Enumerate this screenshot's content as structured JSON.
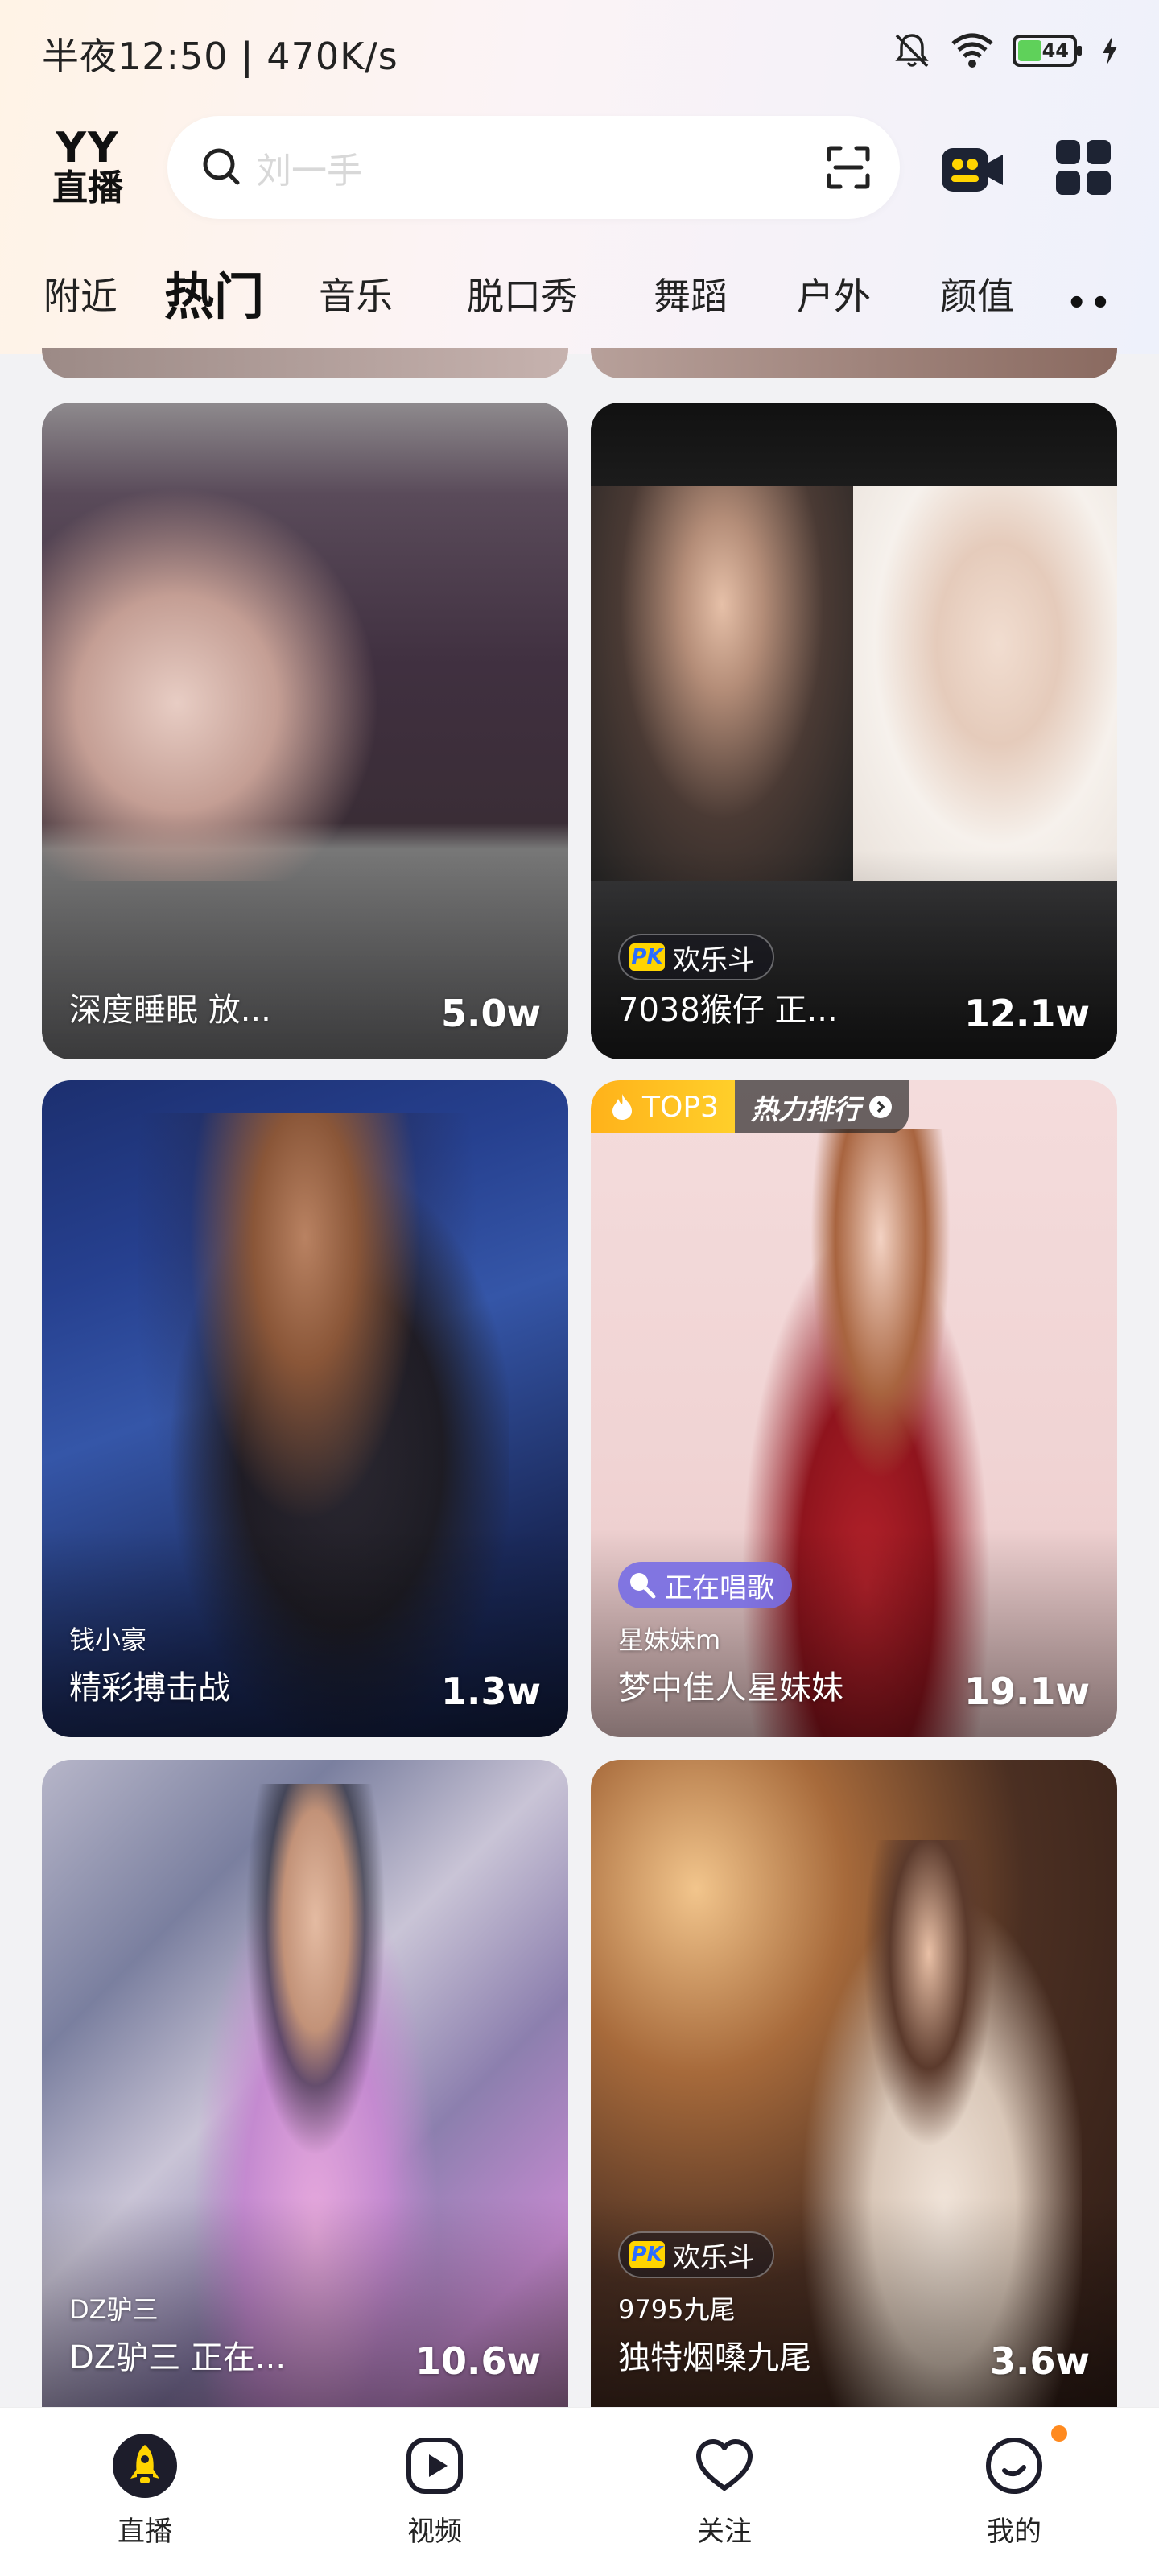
{
  "status_bar": {
    "time": "半夜12:50 | 470K/s",
    "battery": "44"
  },
  "header": {
    "logo_top": "YY",
    "logo_bottom": "直播",
    "search_placeholder": "刘一手"
  },
  "tabs": [
    {
      "label": "附近"
    },
    {
      "label": "热门"
    },
    {
      "label": "音乐"
    },
    {
      "label": "脱口秀"
    },
    {
      "label": "舞蹈"
    },
    {
      "label": "户外"
    },
    {
      "label": "颜值"
    }
  ],
  "more_label": "••",
  "cards": [
    {
      "title": "深度睡眠 放...",
      "count": "5.0w"
    },
    {
      "badge": "欢乐斗",
      "title": "7038猴仔 正...",
      "count": "12.1w"
    },
    {
      "host": "钱小豪",
      "title": "精彩搏击战",
      "count": "1.3w"
    },
    {
      "rank": "TOP3",
      "rank_label": "热力排行",
      "badge": "正在唱歌",
      "host": "星妹妹m",
      "title": "梦中佳人星妹妹",
      "count": "19.1w"
    },
    {
      "host": "DZ驴三",
      "title": "DZ驴三 正在...",
      "count": "10.6w"
    },
    {
      "badge": "欢乐斗",
      "host": "9795九尾",
      "title": "独特烟嗓九尾",
      "count": "3.6w"
    }
  ],
  "bottom_nav": [
    {
      "label": "直播"
    },
    {
      "label": "视频"
    },
    {
      "label": "关注"
    },
    {
      "label": "我的"
    }
  ],
  "colors": {
    "accent_yellow": "#ffd400",
    "notification_dot": "#ff8a1f",
    "pill_purple": "#786ee6"
  }
}
